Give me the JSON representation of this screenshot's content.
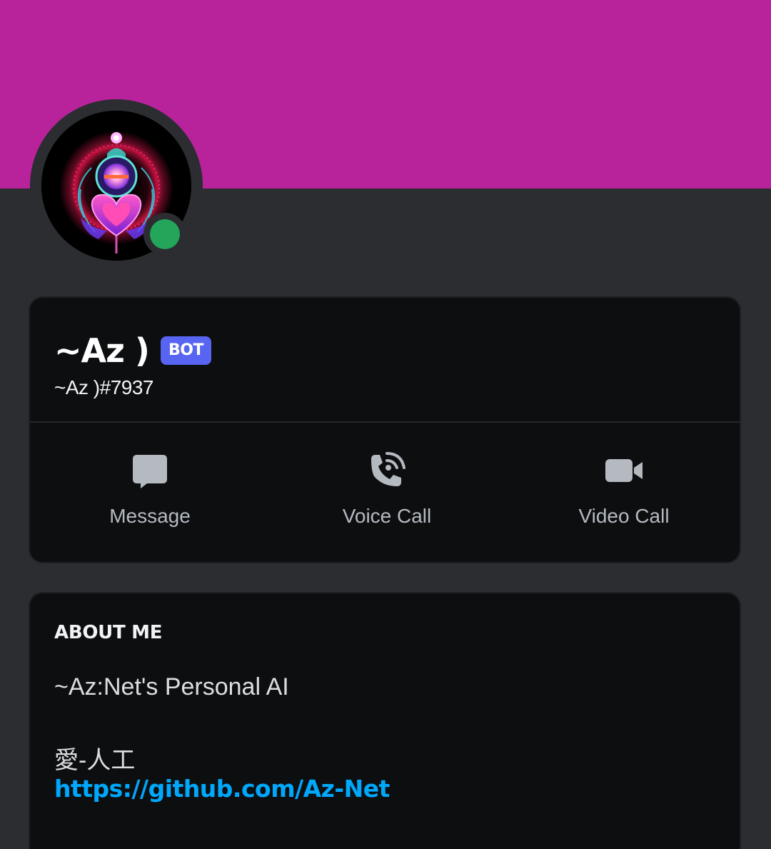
{
  "colors": {
    "banner": "#b8229b",
    "background": "#2b2d31",
    "card": "#0d0e10",
    "status_online": "#23a55a",
    "bot_badge": "#5865f2",
    "link": "#00a8fc"
  },
  "profile": {
    "display_name": "~Az )",
    "badge": "BOT",
    "tag": "~Az )#7937",
    "status": "online"
  },
  "actions": [
    {
      "label": "Message",
      "icon": "chat-bubble-icon"
    },
    {
      "label": "Voice Call",
      "icon": "phone-call-icon"
    },
    {
      "label": "Video Call",
      "icon": "video-camera-icon"
    }
  ],
  "about": {
    "heading": "ABOUT ME",
    "line1": "~Az:Net's Personal AI",
    "line2": "愛-人工",
    "link": "https://github.com/Az-Net"
  }
}
